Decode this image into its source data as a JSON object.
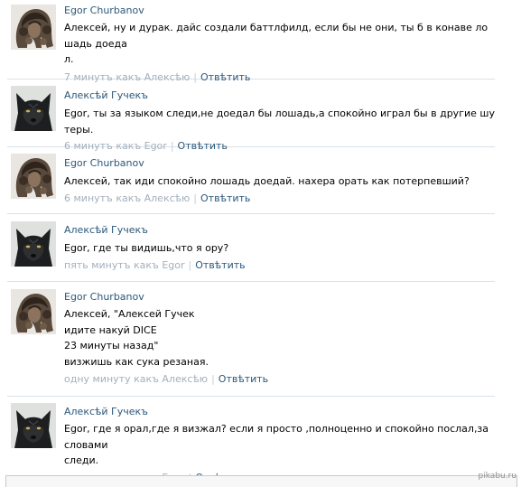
{
  "comments": [
    {
      "author": "Egor Churbanov",
      "avatar_icon": "curly-hair-photo-icon",
      "text": "Алексей, ну и дурак. дайс создали баттлфилд, если бы не они, ты б в конаве лошадь доеда\nл.",
      "time": "7 минутъ какъ Алексѣю",
      "reply": "Отвѣтить"
    },
    {
      "author": "Алексѣй Гучекъ",
      "avatar_icon": "black-wolf-photo-icon",
      "text": "Egor, ты за языком следи,не доедал бы лошадь,а спокойно играл бы в другие шутеры.",
      "time": "6 минутъ какъ Egor",
      "reply": "Отвѣтить"
    },
    {
      "author": "Egor Churbanov",
      "avatar_icon": "curly-hair-photo-icon",
      "text": "Алексей, так иди спокойно лошадь доедай. нахера орать как потерпевший?",
      "time": "6 минутъ какъ Алексѣю",
      "reply": "Отвѣтить"
    },
    {
      "author": "Алексѣй Гучекъ",
      "avatar_icon": "black-wolf-photo-icon",
      "text": "Egor, где ты видишь,что я ору?",
      "time": "пять минутъ какъ Egor",
      "reply": "Отвѣтить"
    },
    {
      "author": "Egor Churbanov",
      "avatar_icon": "curly-hair-photo-icon",
      "text": "Алексей, \"Алексей Гучек\nидите накуй DICE\n23 минуты назад\"\nвизжишь как сука резаная.",
      "time": "одну минуту какъ Алексѣю",
      "reply": "Отвѣтить"
    },
    {
      "author": "Алексѣй Гучекъ",
      "avatar_icon": "black-wolf-photo-icon",
      "text": "Egor, где я орал,где я визжал? если я просто ,полноценно и спокойно послал,за словами\nследи.",
      "time": "одну минуту какъ Egor",
      "reply": "Отвѣтить"
    }
  ],
  "separator": "|",
  "watermark": "pikabu.ru"
}
